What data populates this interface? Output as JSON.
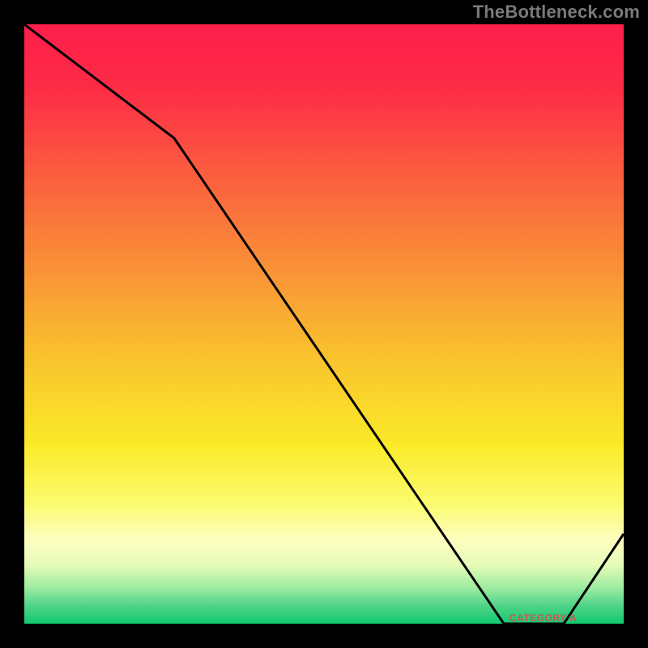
{
  "watermark": "TheBottleneck.com",
  "chart_data": {
    "type": "line",
    "title": "",
    "xlabel": "",
    "ylabel": "",
    "xlim": [
      0,
      100
    ],
    "ylim": [
      0,
      100
    ],
    "x": [
      0,
      25,
      80,
      90,
      100
    ],
    "values": [
      100,
      81,
      0,
      0,
      15
    ],
    "notch_y_top": 7,
    "gradient_stops": [
      {
        "offset": "0%",
        "color": "#fd1f4a"
      },
      {
        "offset": "10%",
        "color": "#fd2a47"
      },
      {
        "offset": "25%",
        "color": "#fb5d3f"
      },
      {
        "offset": "40%",
        "color": "#f98f37"
      },
      {
        "offset": "55%",
        "color": "#f9c12e"
      },
      {
        "offset": "70%",
        "color": "#faea28"
      },
      {
        "offset": "80%",
        "color": "#fcfb70"
      },
      {
        "offset": "86%",
        "color": "#fdfec0"
      },
      {
        "offset": "90%",
        "color": "#e9fcb9"
      },
      {
        "offset": "94%",
        "color": "#9deca0"
      },
      {
        "offset": "97%",
        "color": "#4fd387"
      },
      {
        "offset": "100%",
        "color": "#12c971"
      }
    ],
    "tick_label": "CATEGORY A"
  }
}
